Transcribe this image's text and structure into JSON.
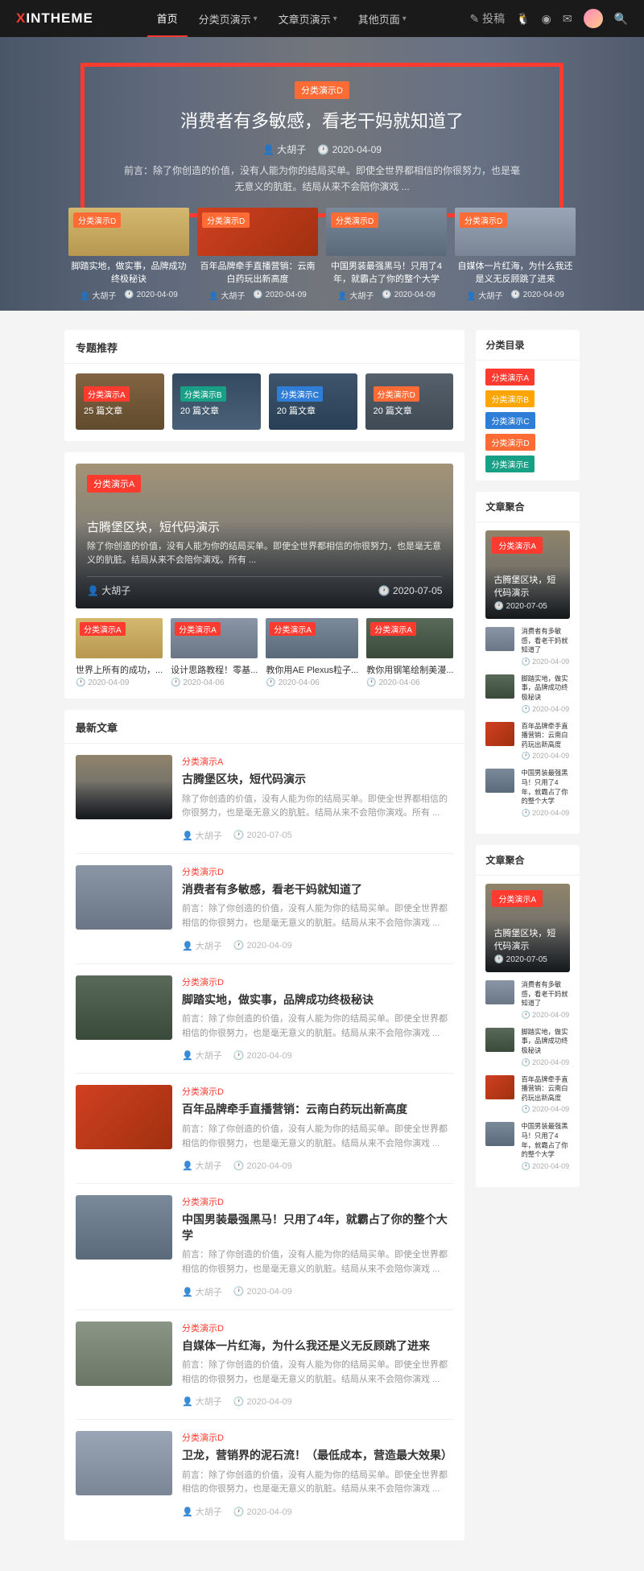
{
  "header": {
    "logo_x": "X",
    "logo_rest": "INTHEME",
    "nav": [
      {
        "label": "首页",
        "active": true,
        "chevron": false
      },
      {
        "label": "分类页演示",
        "active": false,
        "chevron": true
      },
      {
        "label": "文章页演示",
        "active": false,
        "chevron": true
      },
      {
        "label": "其他页面",
        "active": false,
        "chevron": true
      }
    ],
    "contribute_label": "投稿"
  },
  "hero": {
    "category": "分类演示D",
    "title": "消费者有多敏感，看老干妈就知道了",
    "author": "大胡子",
    "date": "2020-04-09",
    "excerpt": "前言：除了你创造的价值，没有人能为你的结局买单。即使全世界都相信的你很努力，也是毫无意义的肮脏。结局从来不会陪你演戏 ..."
  },
  "hero_cards": [
    {
      "cat": "分类演示D",
      "title": "脚踏实地，做实事，品牌成功终极秘诀",
      "author": "大胡子",
      "date": "2020-04-09"
    },
    {
      "cat": "分类演示D",
      "title": "百年品牌牵手直播营销：云南白药玩出新高度",
      "author": "大胡子",
      "date": "2020-04-09"
    },
    {
      "cat": "分类演示D",
      "title": "中国男装最强黑马！只用了4年，就霸占了你的整个大学",
      "author": "大胡子",
      "date": "2020-04-09"
    },
    {
      "cat": "分类演示D",
      "title": "自媒体一片红海，为什么我还是义无反顾跳了进来",
      "author": "大胡子",
      "date": "2020-04-09"
    }
  ],
  "topics": {
    "heading": "专题推荐",
    "items": [
      {
        "cat": "分类演示A",
        "count": "25 篇文章",
        "color": "#ff3b30"
      },
      {
        "cat": "分类演示B",
        "count": "20 篇文章",
        "color": "#17a085"
      },
      {
        "cat": "分类演示C",
        "count": "20 篇文章",
        "color": "#2e7dd6"
      },
      {
        "cat": "分类演示D",
        "count": "20 篇文章",
        "color": "#ff6b35"
      }
    ]
  },
  "feature": {
    "cat": "分类演示A",
    "title": "古腾堡区块，短代码演示",
    "excerpt": "除了你创造的价值，没有人能为你的结局买单。即使全世界都相信的你很努力，也是毫无意义的肮脏。结局从来不会陪你演戏。所有 ...",
    "author": "大胡子",
    "date": "2020-07-05",
    "row": [
      {
        "cat": "分类演示A",
        "title": "世界上所有的成功，...",
        "date": "2020-04-09"
      },
      {
        "cat": "分类演示A",
        "title": "设计思路教程！零基...",
        "date": "2020-04-06"
      },
      {
        "cat": "分类演示A",
        "title": "教你用AE Plexus粒子...",
        "date": "2020-04-06"
      },
      {
        "cat": "分类演示A",
        "title": "教你用钢笔绘制美漫...",
        "date": "2020-04-06"
      }
    ]
  },
  "latest": {
    "heading": "最新文章",
    "items": [
      {
        "cat": "分类演示A",
        "title": "古腾堡区块，短代码演示",
        "excerpt": "除了你创造的价值，没有人能为你的结局买单。即使全世界都相信的你很努力，也是毫无意义的肮脏。结局从来不会陪你演戏。所有 ...",
        "author": "大胡子",
        "date": "2020-07-05",
        "bg": "bg-lamp"
      },
      {
        "cat": "分类演示D",
        "title": "消费者有多敏感，看老干妈就知道了",
        "excerpt": "前言：除了你创造的价值，没有人能为你的结局买单。即使全世界都相信的你很努力，也是毫无意义的肮脏。结局从来不会陪你演戏 ...",
        "author": "大胡子",
        "date": "2020-04-09",
        "bg": "bg-b"
      },
      {
        "cat": "分类演示D",
        "title": "脚踏实地，做实事，品牌成功终极秘诀",
        "excerpt": "前言：除了你创造的价值，没有人能为你的结局买单。即使全世界都相信的你很努力，也是毫无意义的肮脏。结局从来不会陪你演戏 ...",
        "author": "大胡子",
        "date": "2020-04-09",
        "bg": "bg-e"
      },
      {
        "cat": "分类演示D",
        "title": "百年品牌牵手直播营销：云南白药玩出新高度",
        "excerpt": "前言：除了你创造的价值，没有人能为你的结局买单。即使全世界都相信的你很努力，也是毫无意义的肮脏。结局从来不会陪你演戏 ...",
        "author": "大胡子",
        "date": "2020-04-09",
        "bg": "bg-c"
      },
      {
        "cat": "分类演示D",
        "title": "中国男装最强黑马！只用了4年，就霸占了你的整个大学",
        "excerpt": "前言：除了你创造的价值，没有人能为你的结局买单。即使全世界都相信的你很努力，也是毫无意义的肮脏。结局从来不会陪你演戏 ...",
        "author": "大胡子",
        "date": "2020-04-09",
        "bg": "bg-d"
      },
      {
        "cat": "分类演示D",
        "title": "自媒体一片红海，为什么我还是义无反顾跳了进来",
        "excerpt": "前言：除了你创造的价值，没有人能为你的结局买单。即使全世界都相信的你很努力，也是毫无意义的肮脏。结局从来不会陪你演戏 ...",
        "author": "大胡子",
        "date": "2020-04-09",
        "bg": "bg-g"
      },
      {
        "cat": "分类演示D",
        "title": "卫龙，营销界的泥石流！（最低成本，营造最大效果）",
        "excerpt": "前言：除了你创造的价值，没有人能为你的结局买单。即使全世界都相信的你很努力，也是毫无意义的肮脏。结局从来不会陪你演戏 ...",
        "author": "大胡子",
        "date": "2020-04-09",
        "bg": "bg-f"
      }
    ]
  },
  "sidebar": {
    "cat_heading": "分类目录",
    "cats": [
      {
        "label": "分类演示A",
        "cls": "a"
      },
      {
        "label": "分类演示B",
        "cls": "b"
      },
      {
        "label": "分类演示C",
        "cls": "c"
      },
      {
        "label": "分类演示D",
        "cls": "d"
      },
      {
        "label": "分类演示E",
        "cls": "e"
      }
    ],
    "agg_heading": "文章聚合",
    "feat": {
      "cat": "分类演示A",
      "title": "古腾堡区块，短代码演示",
      "date": "2020-07-05"
    },
    "items": [
      {
        "title": "消费者有多敏感，看老干妈就知道了",
        "date": "2020-04-09",
        "bg": "bg-b"
      },
      {
        "title": "脚踏实地，做实事，品牌成功终极秘诀",
        "date": "2020-04-09",
        "bg": "bg-e"
      },
      {
        "title": "百年品牌牵手直播营销：云南白药玩出新高度",
        "date": "2020-04-09",
        "bg": "bg-c"
      },
      {
        "title": "中国男装最强黑马！只用了4年，就霸占了你的整个大学",
        "date": "2020-04-09",
        "bg": "bg-d"
      }
    ]
  }
}
